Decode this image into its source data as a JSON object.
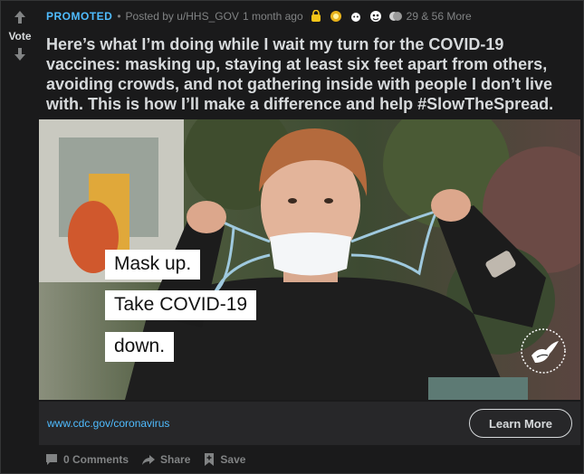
{
  "vote": {
    "label": "Vote"
  },
  "meta": {
    "promoted": "PROMOTED",
    "separator": "•",
    "posted_by": "Posted by u/HHS_GOV",
    "age": "1 month ago",
    "awards_summary": "29 & 56 More",
    "award_icons": [
      "coin-award-icon",
      "silver-award-icon",
      "wholesome-award-icon",
      "helpful-award-icon",
      "gold-award-icon"
    ]
  },
  "post": {
    "title": "Here’s what I’m doing while I wait my turn for the COVID-19 vaccines: masking up, staying at least six feet apart from others, avoiding crowds, and not gathering inside with people I don’t live with. This is how I’ll make a difference and help #SlowTheSpread."
  },
  "image": {
    "lines": [
      "Mask up.",
      "Take COVID-19",
      "down."
    ]
  },
  "linkbar": {
    "url": "www.cdc.gov/coronavirus",
    "button": "Learn More"
  },
  "footer": {
    "comments": "0 Comments",
    "share": "Share",
    "save": "Save"
  },
  "colors": {
    "background": "#1a1a1b",
    "accent": "#4fbcff",
    "text": "#d7dadc",
    "muted": "#818384",
    "linkbar": "#272729"
  }
}
